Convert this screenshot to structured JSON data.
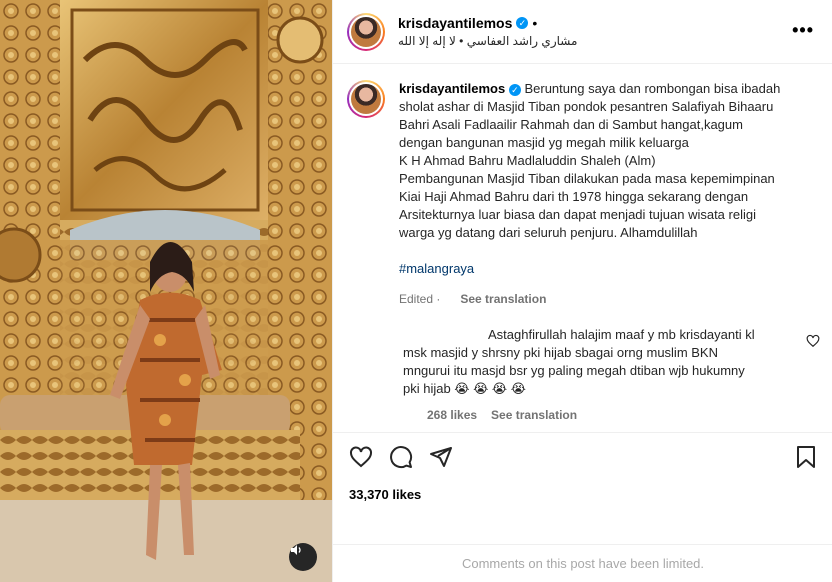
{
  "post": {
    "username": "krisdayantilemos",
    "verified_glyph": "✓",
    "dot": "•",
    "audio": "مشاري راشد العفاسي • لا إله إلا الله",
    "more_glyph": "•••",
    "audio_icon": "speaker-icon"
  },
  "caption": {
    "username": "krisdayantilemos",
    "text_lines": [
      "Beruntung saya dan rombongan bisa ibadah",
      "sholat ashar di Masjid Tiban pondok pesantren Salafiyah Bihaaru",
      "Bahri Asali Fadlaailir Rahmah dan di Sambut hangat,kagum",
      "dengan bangunan masjid yg megah milik keluarga",
      "K H Ahmad Bahru Madlaluddin Shaleh (Alm)",
      "Pembangunan Masjid Tiban dilakukan pada masa kepemimpinan",
      "Kiai Haji Ahmad Bahru dari th 1978 hingga sekarang dengan",
      "Arsitekturnya luar biasa dan dapat menjadi tujuan wisata religi",
      "warga yg datang dari seluruh penjuru. Alhamdulillah"
    ],
    "hashtag": "#malangraya",
    "edited": "Edited",
    "edited_dot": "·",
    "see_translation": "See translation"
  },
  "comment": {
    "text_lines": [
      "Astaghfirullah halajim maaf y mb krisdayanti kl",
      "msk masjid y shrsny pki hijab sbagai orng muslim BKN",
      "mngurui itu masjd bsr yg paling megah dtiban wjb hukumny",
      "pki hijab 😭 😭 😭 😭"
    ],
    "likes": "268 likes",
    "see_translation": "See translation"
  },
  "actions": {
    "likes": "33,370 likes",
    "limited": "Comments on this post have been limited."
  }
}
